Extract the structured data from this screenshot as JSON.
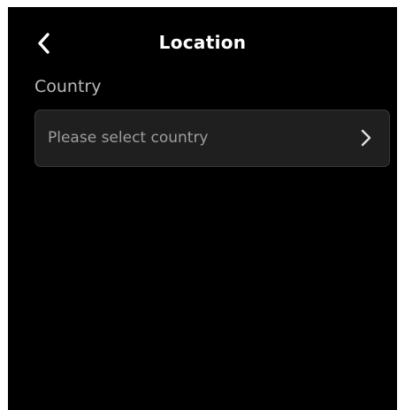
{
  "header": {
    "title": "Location",
    "back_icon": "chevron-left-icon"
  },
  "form": {
    "country": {
      "label": "Country",
      "placeholder": "Please select country",
      "chevron_icon": "chevron-right-icon"
    }
  },
  "colors": {
    "background": "#000000",
    "field_background": "#1f1f1f",
    "label_text": "#b9b9b9",
    "placeholder_text": "#9e9e9e"
  }
}
